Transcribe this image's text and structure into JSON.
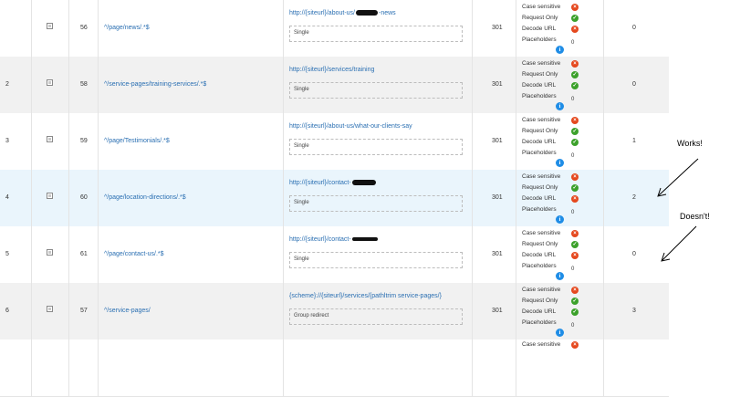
{
  "options": {
    "case_label": "Case sensitive",
    "request_label": "Request Only",
    "decode_label": "Decode URL",
    "placeholders_label": "Placeholders"
  },
  "rows": [
    {
      "num": "",
      "id": "56",
      "pattern": "^/page/news/.*$",
      "url_a": "http://{siteurl}/about-us/",
      "url_b": "-news",
      "note": "Single",
      "code": "301",
      "case_state": "off",
      "request_state": "on",
      "decode_state": "off",
      "placeholders": "0",
      "hits": "0"
    },
    {
      "num": "2",
      "id": "58",
      "pattern": "^/service-pages/training-services/.*$",
      "url_a": "http://{siteurl}/services/training",
      "url_b": "",
      "note": "Single",
      "code": "301",
      "case_state": "off",
      "request_state": "on",
      "decode_state": "on",
      "placeholders": "0",
      "hits": "0"
    },
    {
      "num": "3",
      "id": "59",
      "pattern": "^/page/Testimonials/.*$",
      "url_a": "http://{siteurl}/about-us/what-our-clients-say",
      "url_b": "",
      "note": "Single",
      "code": "301",
      "case_state": "off",
      "request_state": "on",
      "decode_state": "on",
      "placeholders": "0",
      "hits": "1"
    },
    {
      "num": "4",
      "id": "60",
      "pattern": "^/page/location-directions/.*$",
      "url_a": "http://{siteurl}/contact-",
      "url_b": "",
      "note": "Single",
      "code": "301",
      "case_state": "off",
      "request_state": "on",
      "decode_state": "off",
      "placeholders": "0",
      "hits": "2"
    },
    {
      "num": "5",
      "id": "61",
      "pattern": "^/page/contact-us/.*$",
      "url_a": "http://{siteurl}/contact-",
      "url_b": "",
      "note": "Single",
      "code": "301",
      "case_state": "off",
      "request_state": "on",
      "decode_state": "off",
      "placeholders": "0",
      "hits": "0"
    },
    {
      "num": "6",
      "id": "57",
      "pattern": "^/service-pages/",
      "url_a": "{scheme}://{siteurl}/services/{pathltrim service-pages/}",
      "url_b": "",
      "note": "Group redirect",
      "code": "301",
      "case_state": "off",
      "request_state": "on",
      "decode_state": "on",
      "placeholders": "0",
      "hits": "3"
    },
    {
      "num": "",
      "id": "",
      "pattern": "",
      "url_a": "",
      "url_b": "",
      "note": "",
      "code": "",
      "case_state": "off",
      "request_state": "",
      "decode_state": "",
      "placeholders": "",
      "hits": ""
    }
  ],
  "annotations": {
    "works": "Works!",
    "doesnt": "Doesn't!"
  }
}
